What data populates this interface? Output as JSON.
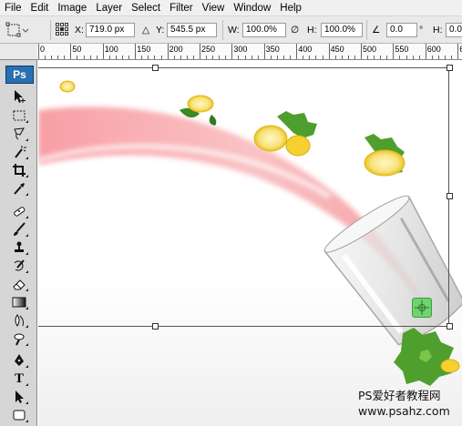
{
  "menubar": {
    "items": [
      "File",
      "Edit",
      "Image",
      "Layer",
      "Select",
      "Filter",
      "View",
      "Window",
      "Help"
    ]
  },
  "options": {
    "x_label": "X:",
    "x_value": "719.0 px",
    "y_label": "Y:",
    "y_value": "545.5 px",
    "w_label": "W:",
    "w_value": "100.0%",
    "h_label": "H:",
    "h_value": "100.0%",
    "angle_value": "0.0",
    "degree_symbol": "°",
    "hskew_label": "H:",
    "hskew_value": "0.0"
  },
  "ruler": {
    "labels": [
      "0",
      "50",
      "100",
      "150",
      "200",
      "250",
      "300",
      "350",
      "400",
      "450",
      "500",
      "550",
      "600",
      "650"
    ]
  },
  "tools": {
    "logo": "Ps",
    "items": [
      "move-tool-icon",
      "marquee-tool-icon",
      "lasso-tool-icon",
      "magic-wand-tool-icon",
      "crop-tool-icon",
      "eyedropper-tool-icon",
      "healing-brush-tool-icon",
      "brush-tool-icon",
      "clone-stamp-tool-icon",
      "history-brush-tool-icon",
      "eraser-tool-icon",
      "gradient-tool-icon",
      "blur-tool-icon",
      "dodge-tool-icon",
      "pen-tool-icon",
      "type-tool-icon",
      "path-selection-tool-icon",
      "shape-tool-icon"
    ],
    "type_glyph": "T"
  },
  "canvas": {
    "watermark_line1": "PS爱好者教程网",
    "watermark_line2": "www.psahz.com",
    "colors": {
      "ribbon": "#f7a9ab",
      "lemon": "#f5d33a",
      "leaf": "#4f9f2e",
      "pivot": "#6fd36f"
    }
  }
}
